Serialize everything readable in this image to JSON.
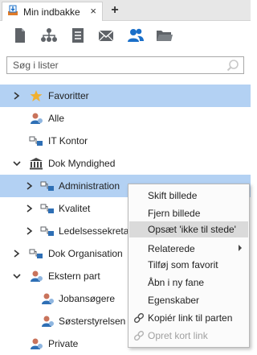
{
  "tab": {
    "title": "Min indbakke",
    "close_glyph": "×",
    "add_glyph": "+"
  },
  "toolbar": {
    "buttons": [
      "document-icon",
      "org-chart-icon",
      "list-icon",
      "mail-icon",
      "people-icon",
      "folder-icon"
    ],
    "active": "people-icon"
  },
  "search": {
    "placeholder": "Søg i lister",
    "value": ""
  },
  "tree": {
    "items": [
      {
        "label": "Favoritter",
        "icon": "star-icon",
        "expander": "collapsed",
        "selected": true
      },
      {
        "label": "Alle",
        "icon": "person-icon"
      },
      {
        "label": "IT Kontor",
        "icon": "unit-icon"
      },
      {
        "label": "Dok Myndighed",
        "icon": "building-icon",
        "expander": "expanded"
      },
      {
        "label": "Administration",
        "icon": "unit-icon",
        "expander": "collapsed",
        "selected": true
      },
      {
        "label": "Kvalitet",
        "icon": "unit-icon",
        "expander": "collapsed"
      },
      {
        "label": "Ledelsessekretar",
        "icon": "unit-icon",
        "expander": "collapsed"
      },
      {
        "label": "Dok Organisation",
        "icon": "unit-icon",
        "expander": "collapsed"
      },
      {
        "label": "Ekstern part",
        "icon": "person-icon",
        "expander": "expanded"
      },
      {
        "label": "Jobansøgere",
        "icon": "person-icon"
      },
      {
        "label": "Søsterstyrelsen",
        "icon": "person-icon"
      },
      {
        "label": "Private",
        "icon": "person-icon"
      }
    ]
  },
  "context_menu": {
    "items": [
      {
        "label": "Skift billede"
      },
      {
        "label": "Fjern billede"
      },
      {
        "label": "Opsæt 'ikke til stede'",
        "highlighted": true
      },
      {
        "label": "Relaterede",
        "submenu": true
      },
      {
        "label": "Tilføj som favorit"
      },
      {
        "label": "Åbn i ny fane"
      },
      {
        "label": "Egenskaber"
      },
      {
        "label": "Kopiér link til parten",
        "icon": "link-icon"
      },
      {
        "label": "Opret kort link",
        "icon": "link-icon",
        "disabled": true
      }
    ]
  },
  "colors": {
    "selection": "#b3d1f3",
    "accent": "#1a6fc9",
    "menu_highlight": "#dadada"
  }
}
